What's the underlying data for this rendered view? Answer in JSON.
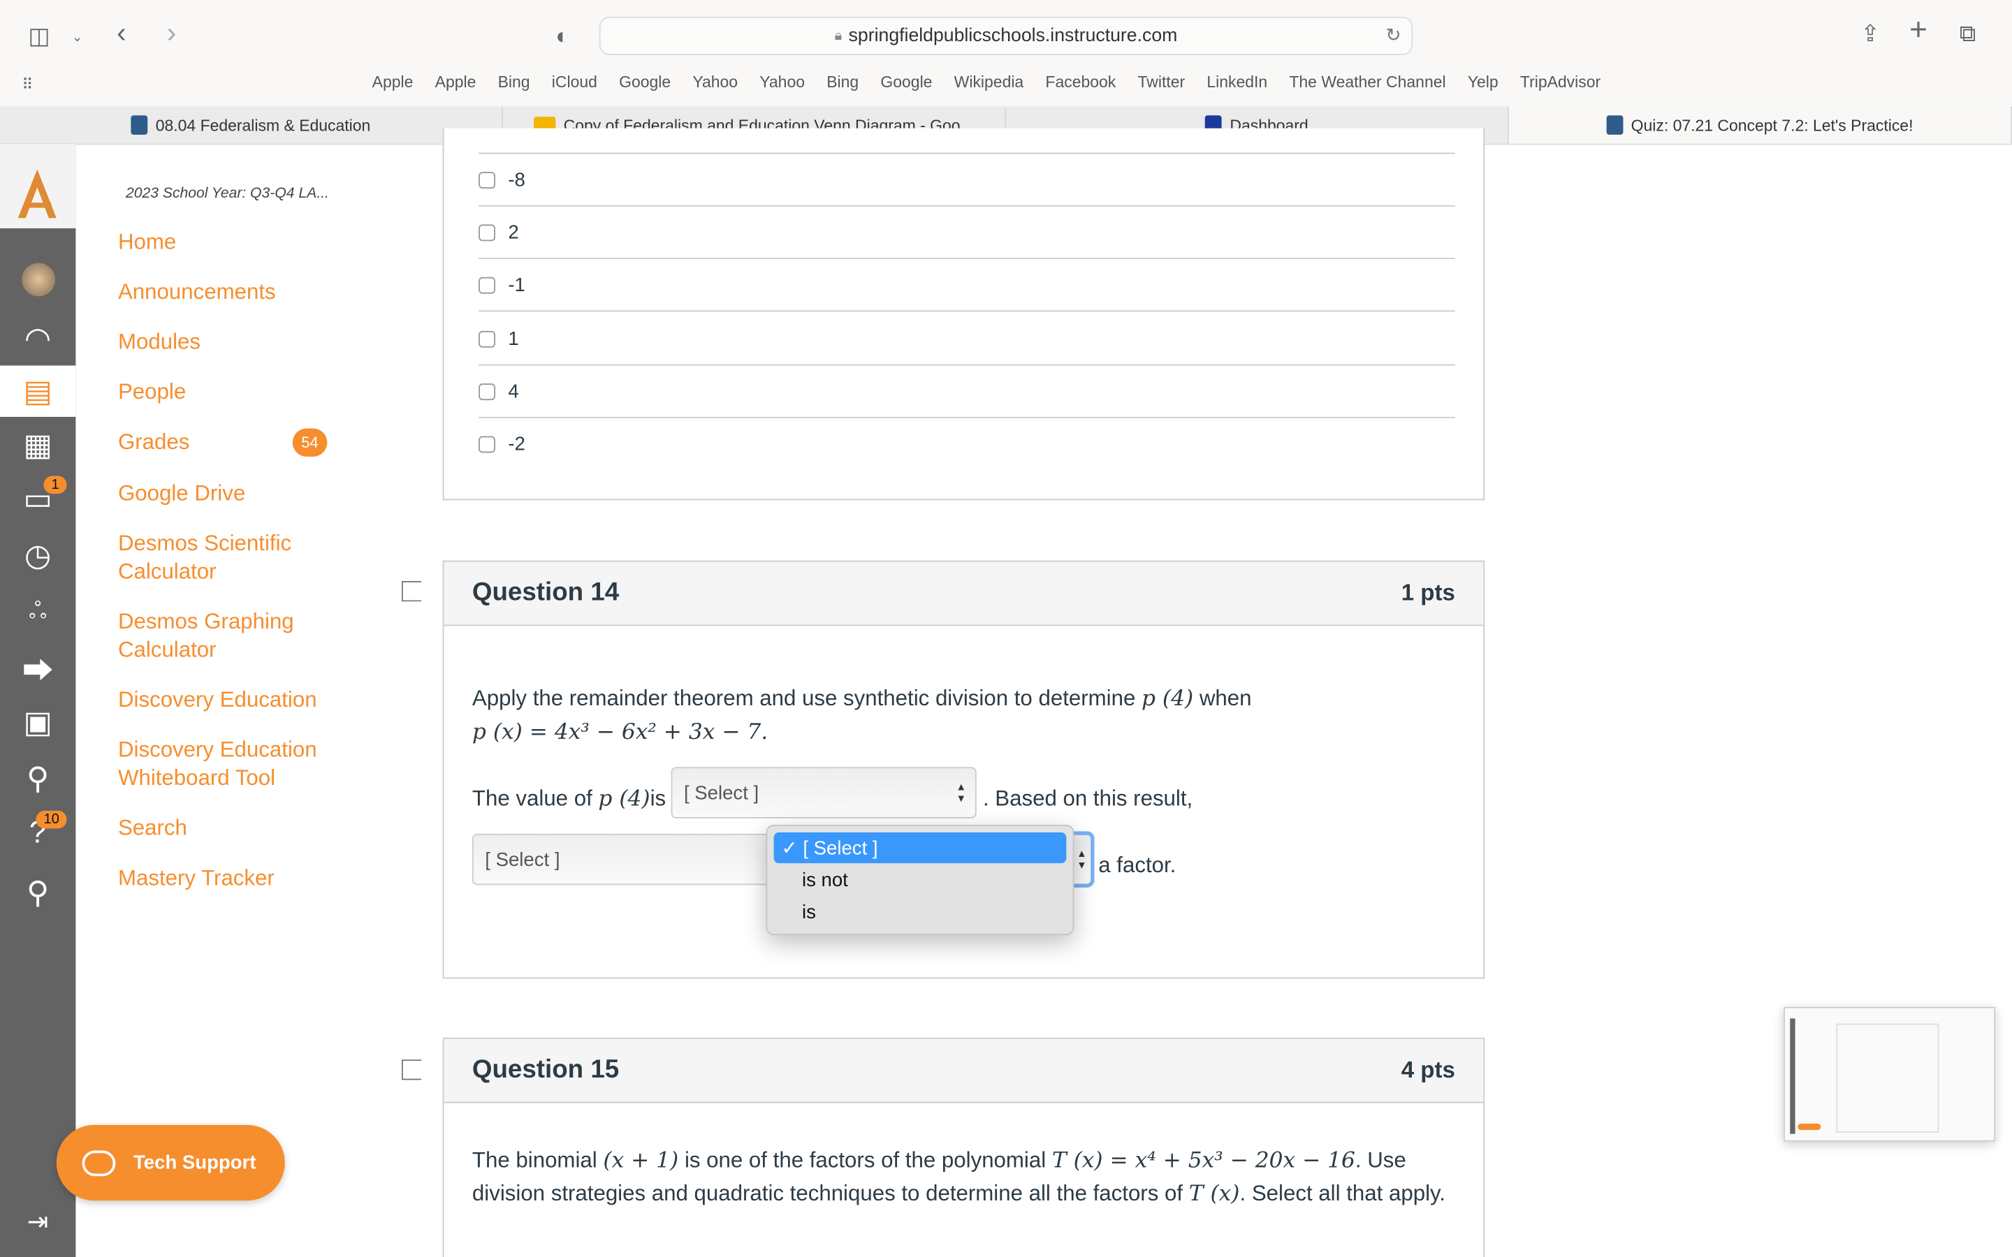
{
  "browser": {
    "url": "springfieldpublicschools.instructure.com",
    "bookmarks": [
      "Apple",
      "Apple",
      "Bing",
      "iCloud",
      "Google",
      "Yahoo",
      "Yahoo",
      "Bing",
      "Google",
      "Wikipedia",
      "Facebook",
      "Twitter",
      "LinkedIn",
      "The Weather Channel",
      "Yelp",
      "TripAdvisor"
    ],
    "tabs": [
      {
        "label": "08.04 Federalism & Education",
        "active": false
      },
      {
        "label": "Copy of Federalism and Education Venn Diagram - Goo...",
        "active": false
      },
      {
        "label": "Dashboard",
        "active": false
      },
      {
        "label": "Quiz: 07.21 Concept 7.2: Let's Practice!",
        "active": true
      }
    ]
  },
  "rail": {
    "inbox_badge": "1",
    "help_badge": "10"
  },
  "course_nav": {
    "course_title": "2023 School Year: Q3-Q4 LA...",
    "items": [
      "Home",
      "Announcements",
      "Modules",
      "People",
      "Grades",
      "Google Drive",
      "Desmos Scientific Calculator",
      "Desmos Graphing Calculator",
      "Discovery Education",
      "Discovery Education Whiteboard Tool",
      "Search",
      "Mastery Tracker"
    ],
    "grades_badge": "54"
  },
  "prev_question": {
    "options": [
      "-8",
      "2",
      "-1",
      "1",
      "4",
      "-2"
    ]
  },
  "q14": {
    "title": "Question 14",
    "points": "1 pts",
    "text1": "Apply the remainder theorem and use synthetic division to determine ",
    "math1": "p (4)",
    "text2": " when",
    "math2": "p (x) = 4x³ − 6x² + 3x − 7.",
    "line2_a": "The value of ",
    "line2_math": "p (4)",
    "line2_b": "is",
    "select1": "[ Select ]",
    "line2_c": ". Based on this result,",
    "select2": "[ Select ]",
    "line3_end": "a factor.",
    "dropdown": [
      "[ Select ]",
      "is not",
      "is"
    ]
  },
  "q15": {
    "title": "Question 15",
    "points": "4 pts",
    "t1": "The binomial ",
    "m1": "(x + 1)",
    "t2": " is  one of the factors of the polynomial ",
    "m2": "T (x) = x⁴ + 5x³ − 20x − 16",
    "t3": ". Use division strategies and quadratic techniques to determine all the factors of ",
    "m3": "T (x)",
    "t4": ". Select all that apply."
  },
  "tech_support": "Tech Support",
  "colors": {
    "accent": "#f68e2e",
    "rail": "#636363",
    "highlight": "#3a98fc"
  }
}
